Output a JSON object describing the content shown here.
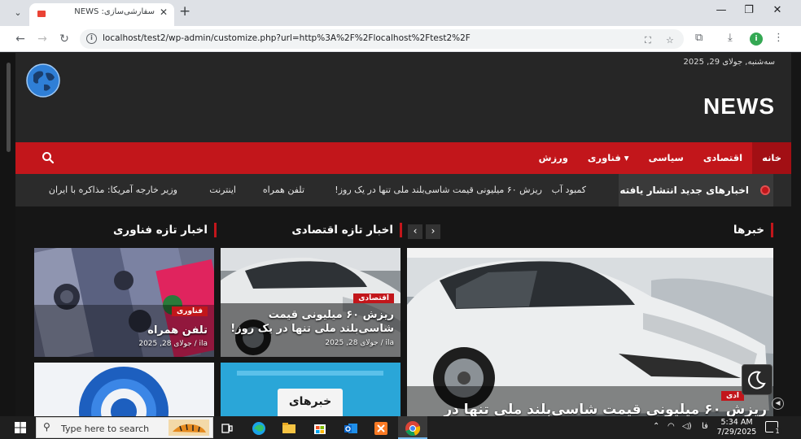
{
  "browser": {
    "tab_title": "سفارشی‌سازی: NEWS",
    "url": "localhost/test2/wp-admin/customize.php?url=http%3A%2F%2Flocalhost%2Ftest2%2F",
    "profile_initial": "i"
  },
  "site": {
    "date": "سه‌شنبه, جولای 29, 2025",
    "title": "NEWS",
    "nav": [
      {
        "label": "خانه",
        "active": true
      },
      {
        "label": "اقتصادی",
        "active": false
      },
      {
        "label": "سیاسی",
        "active": false
      },
      {
        "label": "فناوری",
        "active": false,
        "dropdown": true
      },
      {
        "label": "ورزش",
        "active": false
      }
    ],
    "ticker": {
      "label": "اخبارهای جدید انتشار یافته",
      "items": [
        "ت",
        "کمبود آب",
        "ریزش ۶۰ میلیونی قیمت شاسی‌بلند ملی تنها در یک روز!",
        "تلفن همراه",
        "اینترنت",
        "وزیر خارجه آمریکا: مذاکره با ایران"
      ]
    },
    "sections": {
      "news": "خبرها",
      "economy": "اخبار تازه اقتصادی",
      "tech": "اخبار تازه فناوری"
    },
    "cards": {
      "featured": {
        "badge": "ادی",
        "title": "ریزش ۶۰ میلیونی قیمت شاسی‌بلند ملی تنها در"
      },
      "economy": {
        "badge": "اقتصادی",
        "title": "ریزش ۶۰ میلیونی قیمت شاسی‌بلند ملی تنها در یک روز!",
        "meta": "جولای 28, 2025 / ila"
      },
      "tech": {
        "badge": "فناوری",
        "title": "تلفن همراه",
        "meta": "جولای 28, 2025 / ila"
      },
      "bottom_logo_text": "خبرهای"
    }
  },
  "taskbar": {
    "search_placeholder": "Type here to search",
    "lang": "فا",
    "time": "5:34 AM",
    "date": "7/29/2025",
    "notifications": "1"
  },
  "colors": {
    "accent": "#c2161b",
    "header_bg": "#262626",
    "page_bg": "#161616"
  }
}
